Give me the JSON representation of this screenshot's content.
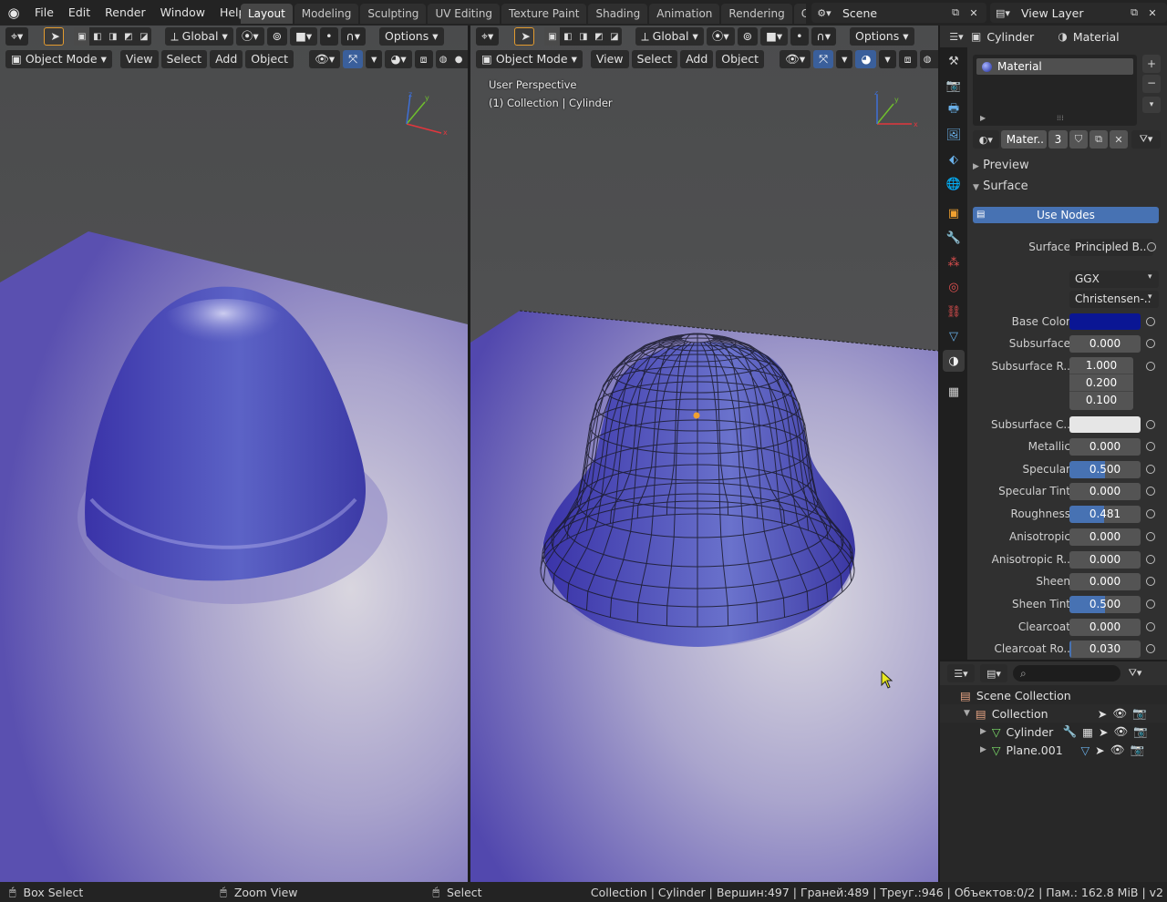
{
  "topbar": {
    "menus": [
      "File",
      "Edit",
      "Render",
      "Window",
      "Help"
    ],
    "workspaces": [
      "Layout",
      "Modeling",
      "Sculpting",
      "UV Editing",
      "Texture Paint",
      "Shading",
      "Animation",
      "Rendering",
      "Comp"
    ],
    "active_workspace": "Layout",
    "scene": "Scene",
    "view_layer": "View Layer"
  },
  "viewport_left": {
    "transform": "Global",
    "options": "Options",
    "mode": "Object Mode",
    "menus": [
      "View",
      "Select",
      "Add",
      "Object"
    ]
  },
  "viewport_right": {
    "transform": "Global",
    "options": "Options",
    "mode": "Object Mode",
    "menus": [
      "View",
      "Select",
      "Add",
      "Object"
    ],
    "overlay_line1": "User Perspective",
    "overlay_line2": "(1) Collection | Cylinder"
  },
  "properties": {
    "object_name": "Cylinder",
    "tab_name": "Material",
    "slot_name": "Material",
    "material_short": "Mater..",
    "users": "3",
    "panel_preview": "Preview",
    "panel_surface": "Surface",
    "use_nodes": "Use Nodes",
    "surface_label": "Surface",
    "surface_value": "Principled B..",
    "distribution": "GGX",
    "subsurface_method": "Christensen-..",
    "base_color_label": "Base Color",
    "base_color": "#0a1694",
    "subsurface_label": "Subsurface",
    "subsurface_value": "0.000",
    "subsurface_radius_label": "Subsurface R..",
    "subsurface_radius": [
      "1.000",
      "0.200",
      "0.100"
    ],
    "subsurface_color_label": "Subsurface C..",
    "subsurface_color": "#e6e6e6",
    "rows": [
      {
        "label": "Metallic",
        "value": "0.000",
        "fill": 0
      },
      {
        "label": "Specular",
        "value": "0.500",
        "fill": 0.5
      },
      {
        "label": "Specular Tint",
        "value": "0.000",
        "fill": 0
      },
      {
        "label": "Roughness",
        "value": "0.481",
        "fill": 0.481
      },
      {
        "label": "Anisotropic",
        "value": "0.000",
        "fill": 0
      },
      {
        "label": "Anisotropic R..",
        "value": "0.000",
        "fill": 0
      },
      {
        "label": "Sheen",
        "value": "0.000",
        "fill": 0
      },
      {
        "label": "Sheen Tint",
        "value": "0.500",
        "fill": 0.5
      },
      {
        "label": "Clearcoat",
        "value": "0.000",
        "fill": 0
      },
      {
        "label": "Clearcoat Ro..",
        "value": "0.030",
        "fill": 0.03
      }
    ]
  },
  "outliner": {
    "scene_collection": "Scene Collection",
    "collection": "Collection",
    "objects": [
      "Cylinder",
      "Plane.001"
    ]
  },
  "statusbar": {
    "box_select": "Box Select",
    "zoom_view": "Zoom View",
    "select": "Select",
    "stats": "Collection | Cylinder | Вершин:497 | Граней:489 | Треуг.:946 | Объектов:0/2 | Пам.: 162.8 MiB | v2"
  },
  "colors": {
    "accent": "#4772b3",
    "active_object": "#e39b2f"
  }
}
